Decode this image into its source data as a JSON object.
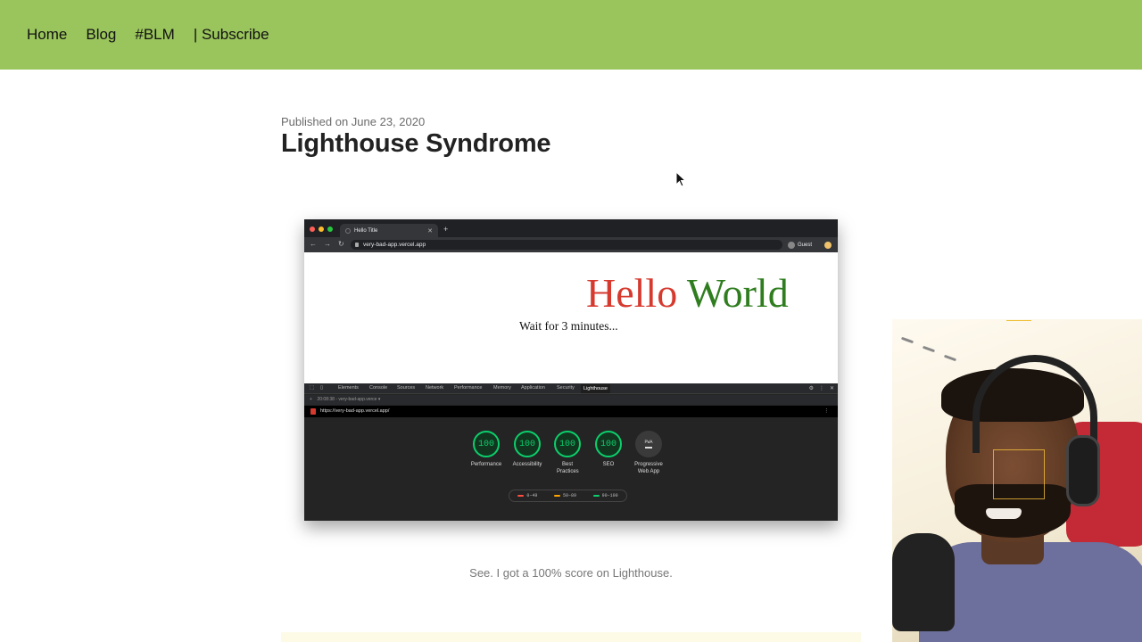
{
  "nav": {
    "items": [
      "Home",
      "Blog",
      "#BLM",
      "| Subscribe"
    ]
  },
  "post": {
    "published": "Published on June 23, 2020",
    "title": "Lighthouse Syndrome",
    "caption": "See. I got a 100% score on Lighthouse."
  },
  "screenshot": {
    "tab_title": "Hello Title",
    "url": "very-bad-app.vercel.app",
    "profile": "Guest",
    "hello_word1": "Hello",
    "hello_word2": "World",
    "wait_text": "Wait for 3 minutes...",
    "devtools": {
      "tabs": [
        "Elements",
        "Console",
        "Sources",
        "Network",
        "Performance",
        "Memory",
        "Application",
        "Security",
        "Lighthouse"
      ],
      "active_tab": "Lighthouse",
      "report_select": "20:08:38 - very-bad-app.verce ▾",
      "report_url": "https://very-bad-app.vercel.app/",
      "scores": [
        {
          "label": "Performance",
          "value": "100"
        },
        {
          "label": "Accessibility",
          "value": "100"
        },
        {
          "label": "Best Practices",
          "value": "100"
        },
        {
          "label": "SEO",
          "value": "100"
        }
      ],
      "pwa": {
        "badge": "PWA",
        "label": "Progressive Web App"
      },
      "legend": [
        "0–49",
        "50–89",
        "90–100"
      ],
      "legend_colors": [
        "#ff4e42",
        "#ffa400",
        "#0cce6b"
      ]
    }
  },
  "colors": {
    "nav_bg": "#9ac45c",
    "score_green": "#0cce6b",
    "hello_red": "#d63a2f",
    "world_green": "#2f7d1f"
  }
}
